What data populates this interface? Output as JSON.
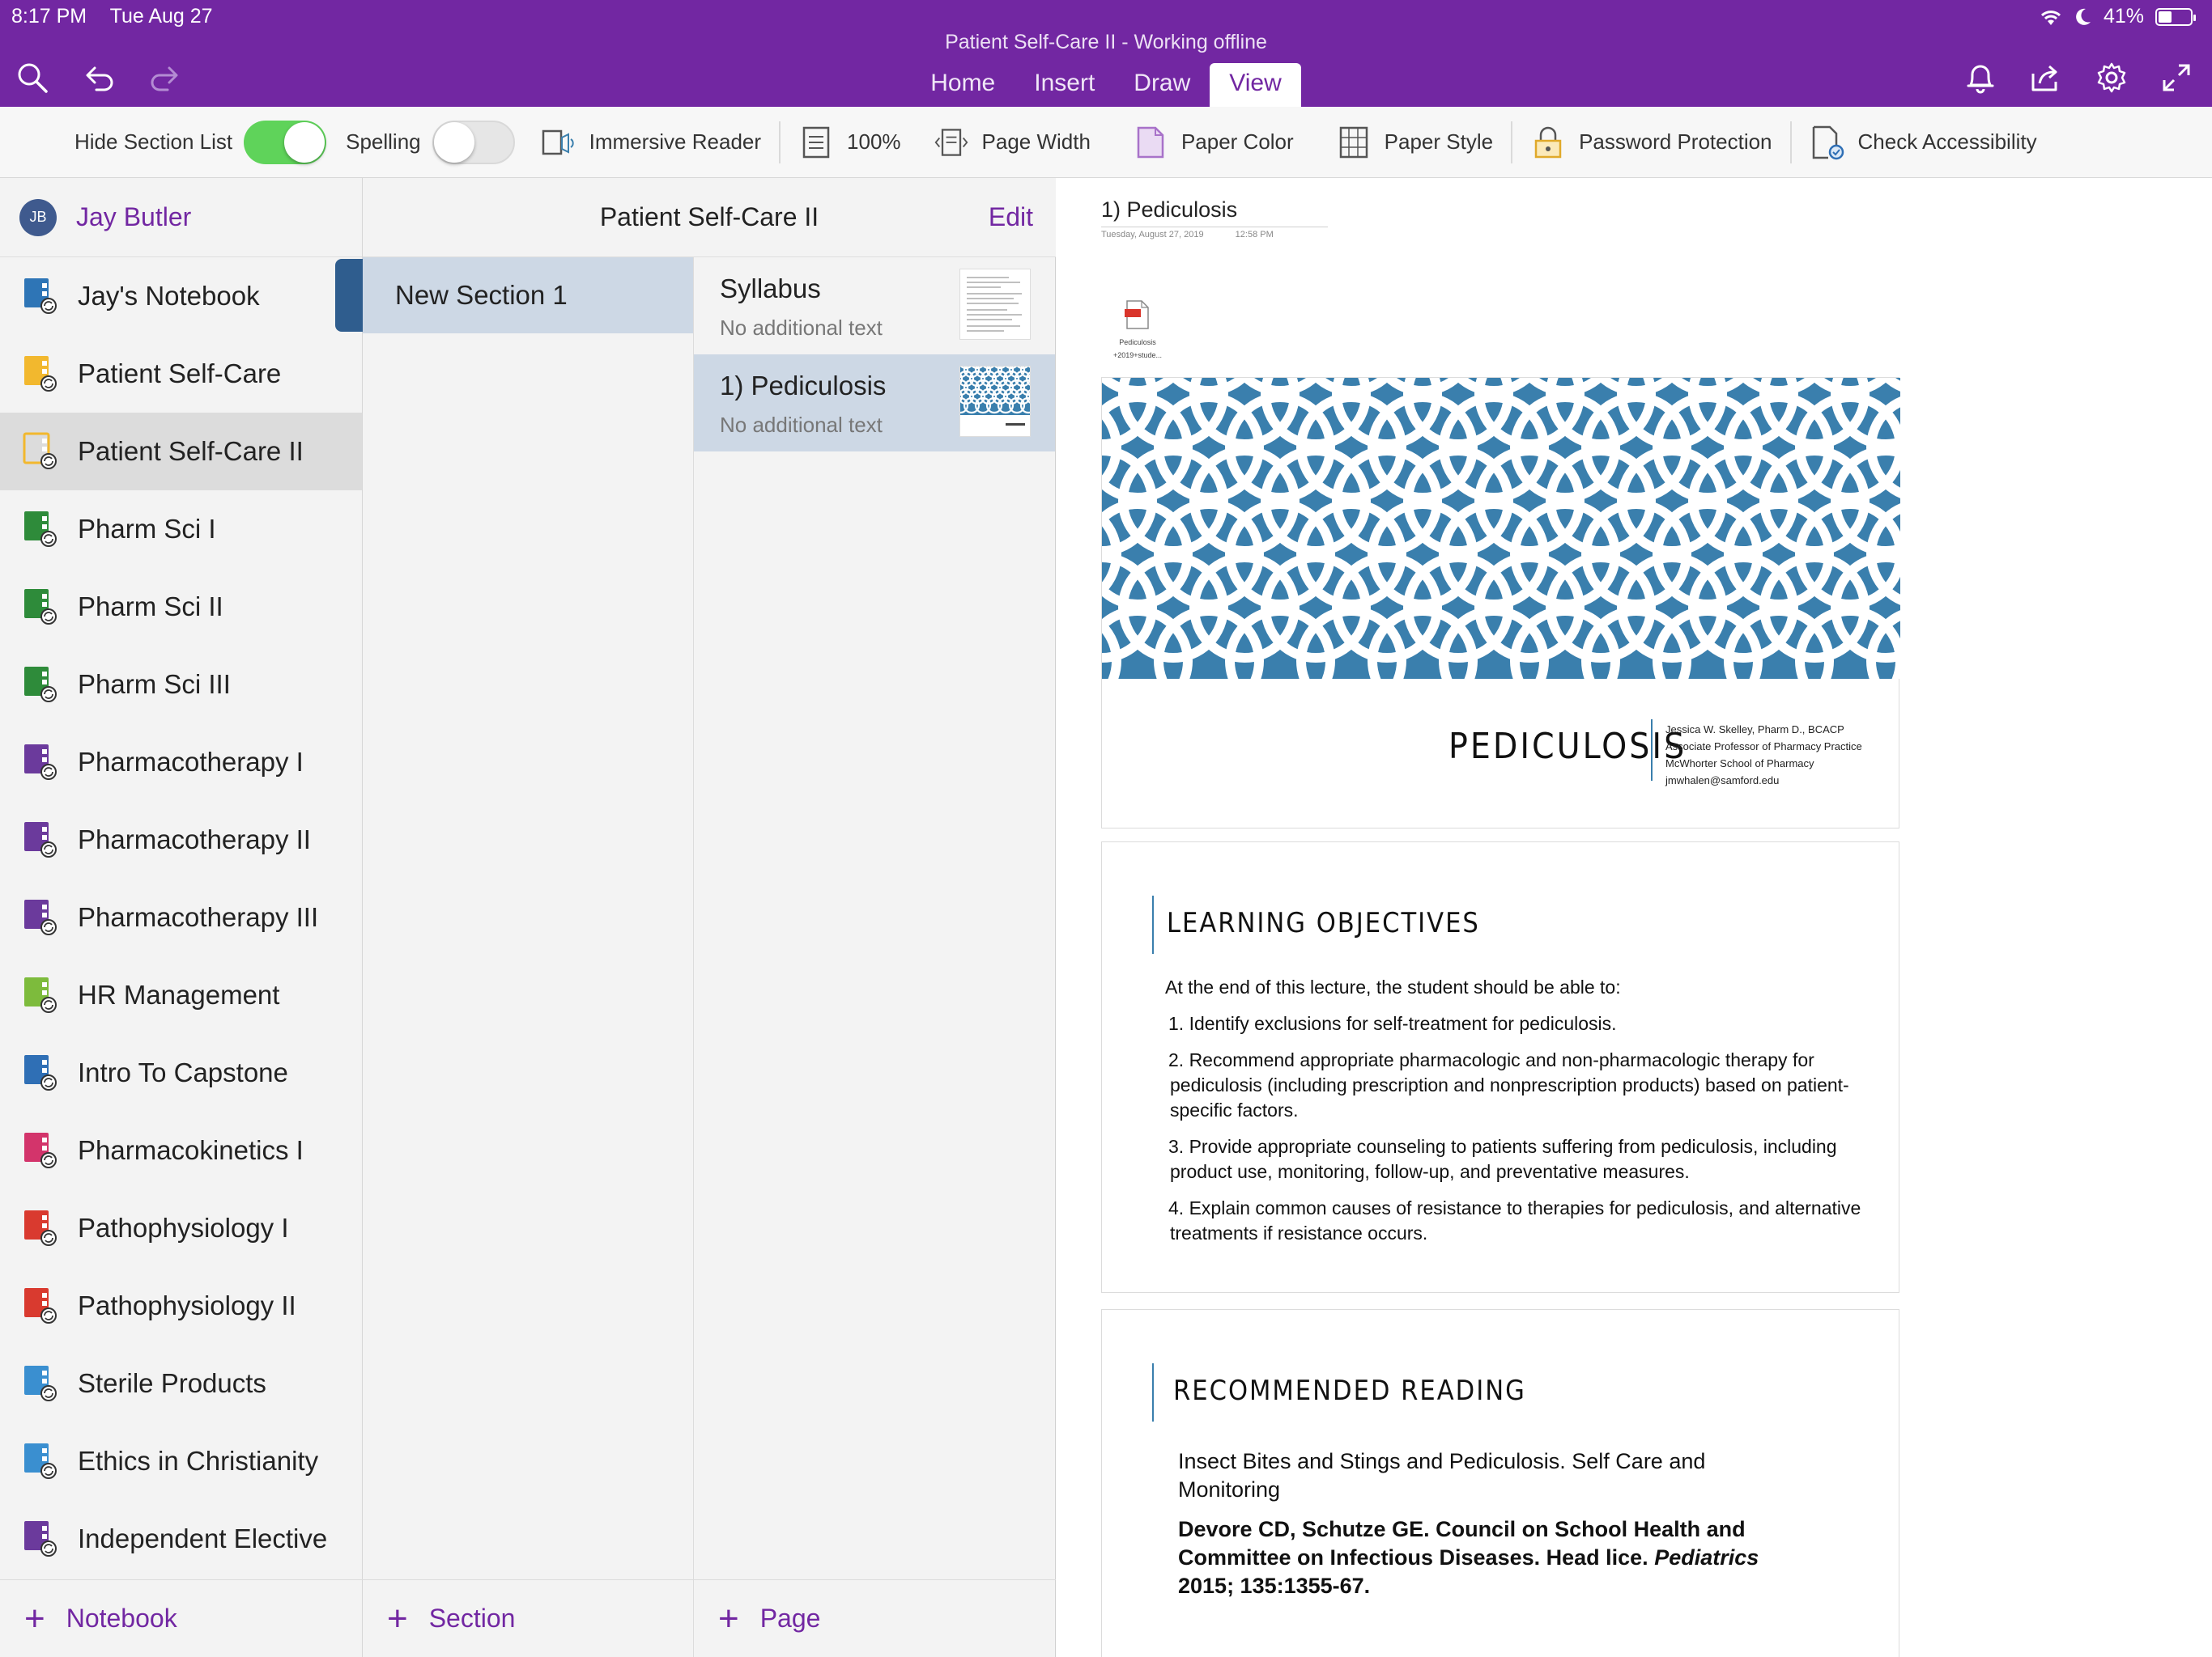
{
  "status_bar": {
    "time": "8:17 PM",
    "date": "Tue Aug 27",
    "battery": "41%",
    "battery_level": 0.41
  },
  "title_bar": {
    "document_title": "Patient Self-Care II - Working offline"
  },
  "tabs": [
    {
      "label": "Home"
    },
    {
      "label": "Insert"
    },
    {
      "label": "Draw"
    },
    {
      "label": "View"
    }
  ],
  "ribbon": {
    "hide_section_list": "Hide Section List",
    "spelling": "Spelling",
    "immersive_reader": "Immersive Reader",
    "zoom": "100%",
    "page_width": "Page Width",
    "paper_color": "Paper Color",
    "paper_style": "Paper Style",
    "password_protection": "Password Protection",
    "check_accessibility": "Check Accessibility"
  },
  "user": {
    "initials": "JB",
    "name": "Jay Butler"
  },
  "notebooks": [
    {
      "label": "Jay's Notebook",
      "color": "#2e75b6"
    },
    {
      "label": "Patient Self-Care",
      "color": "#f2b82e"
    },
    {
      "label": "Patient Self-Care II",
      "color": "#f2b82e"
    },
    {
      "label": "Pharm Sci I",
      "color": "#2e8b3a"
    },
    {
      "label": "Pharm Sci II",
      "color": "#2e8b3a"
    },
    {
      "label": "Pharm Sci III",
      "color": "#2e8b3a"
    },
    {
      "label": "Pharmacotherapy I",
      "color": "#6b3a9c"
    },
    {
      "label": "Pharmacotherapy II",
      "color": "#6b3a9c"
    },
    {
      "label": "Pharmacotherapy III",
      "color": "#6b3a9c"
    },
    {
      "label": "HR Management",
      "color": "#7dbb3c"
    },
    {
      "label": "Intro To Capstone",
      "color": "#2f6fb5"
    },
    {
      "label": "Pharmacokinetics I",
      "color": "#d3346b"
    },
    {
      "label": "Pathophysiology I",
      "color": "#d93a2f"
    },
    {
      "label": "Pathophysiology II",
      "color": "#d93a2f"
    },
    {
      "label": "Sterile Products",
      "color": "#3a8fd0"
    },
    {
      "label": "Ethics in Christianity",
      "color": "#3a8fd0"
    },
    {
      "label": "Independent Elective",
      "color": "#6b3a9c"
    }
  ],
  "footers": {
    "notebook": "Notebook",
    "section": "Section",
    "page": "Page"
  },
  "middle_header": {
    "title": "Patient Self-Care II",
    "edit": "Edit"
  },
  "sections": [
    {
      "label": "New Section 1"
    }
  ],
  "pages": [
    {
      "title": "Syllabus",
      "subtitle": "No additional text"
    },
    {
      "title": "1) Pediculosis",
      "subtitle": "No additional text"
    }
  ],
  "page": {
    "title": "1) Pediculosis",
    "date": "Tuesday, August 27, 2019",
    "time": "12:58 PM",
    "attachment_line1": "Pediculosis",
    "attachment_line2": "+2019+stude...",
    "slide1": {
      "title": "PEDICULOSIS",
      "author": "Jessica W. Skelley, Pharm D., BCACP",
      "position": "Associate Professor of Pharmacy Practice",
      "school": "McWhorter School of Pharmacy",
      "email": "jmwhalen@samford.edu"
    },
    "slide2": {
      "heading": "LEARNING OBJECTIVES",
      "intro": "At the end of this lecture, the student should be able to:",
      "objectives": [
        "1. Identify exclusions for self-treatment for pediculosis.",
        "2. Recommend appropriate pharmacologic and non-pharmacologic therapy for pediculosis (including prescription and nonprescription products) based on patient-specific factors.",
        "3. Provide appropriate counseling to patients suffering from pediculosis, including product use, monitoring, follow-up, and preventative measures.",
        "4. Explain common causes of resistance to therapies for pediculosis, and alternative treatments if resistance occurs."
      ]
    },
    "slide3": {
      "heading": "RECOMMENDED READING",
      "reading1": "Insect Bites and Stings and Pediculosis.  Self Care and Monitoring",
      "reading2_main": "Devore CD, Schutze GE. Council on School Health and Committee on Infectious Diseases. Head lice.",
      "reading2_journal": "Pediatrics",
      "reading2_end": "2015; 135:1355-67."
    }
  },
  "colors": {
    "accent": "#7227a2",
    "section_selected": "#cdd8e5",
    "slide_blue": "#3a7fad",
    "toggle_on": "#5fd35a"
  }
}
